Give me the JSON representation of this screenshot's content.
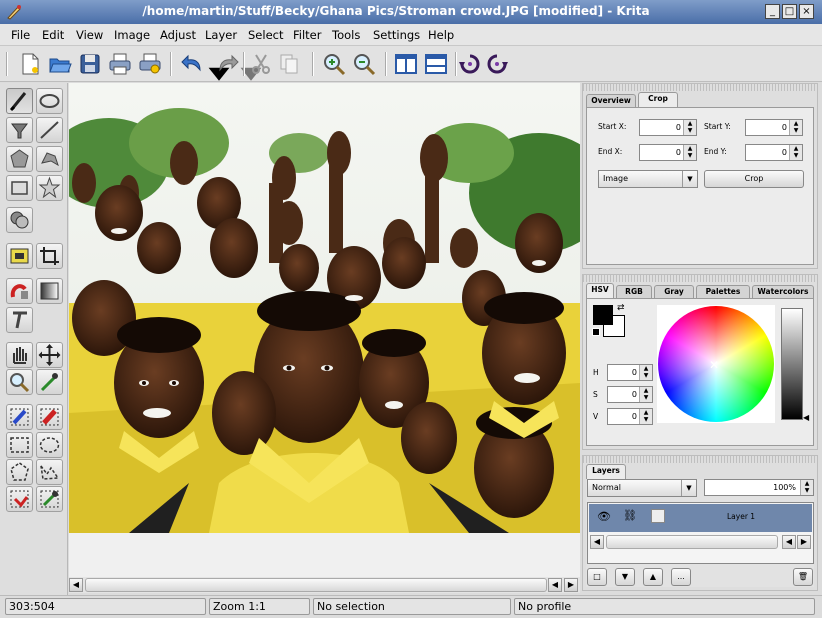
{
  "window": {
    "title": "/home/martin/Stuff/Becky/Ghana Pics/Stroman crowd.JPG [modified] - Krita",
    "buttons": {
      "minimize": "_",
      "maximize": "□",
      "close": "×"
    }
  },
  "menu": [
    {
      "label": "File"
    },
    {
      "label": "Edit"
    },
    {
      "label": "View"
    },
    {
      "label": "Image"
    },
    {
      "label": "Adjust"
    },
    {
      "label": "Layer"
    },
    {
      "label": "Select"
    },
    {
      "label": "Filter"
    },
    {
      "label": "Tools"
    },
    {
      "label": "Settings"
    },
    {
      "label": "Help"
    }
  ],
  "toolbar": {
    "icons": [
      "new-document-icon",
      "open-folder-icon",
      "save-icon",
      "print-icon",
      "print-preview-icon",
      "undo-icon",
      "redo-icon",
      "cut-icon",
      "copy-icon",
      "zoom-in-icon",
      "zoom-out-icon",
      "view-split-vertical-icon",
      "view-split-horizontal-icon",
      "rotate-ccw-icon",
      "rotate-cw-icon"
    ]
  },
  "toolbox": {
    "tools": [
      "brush",
      "ellipse",
      "fill",
      "line",
      "polygon",
      "polyline",
      "rectangle",
      "star",
      "duplicate",
      "move-selection",
      "crop",
      "gradient",
      "filter-brush",
      "text",
      "pan",
      "move",
      "zoom",
      "color-picker",
      "paint-selection",
      "eraser-selection",
      "rect-selection",
      "ellipse-selection",
      "polygon-selection",
      "outline-selection",
      "contiguous-selection",
      "color-selection"
    ]
  },
  "image": {
    "description_hidden": ""
  },
  "tool_options": {
    "tabs": [
      {
        "label": "Overview"
      },
      {
        "label": "Crop"
      }
    ],
    "active_tab": "Crop",
    "start_x_label": "Start X:",
    "start_x_value": "0",
    "start_y_label": "Start Y:",
    "start_y_value": "0",
    "end_x_label": "End X:",
    "end_x_value": "0",
    "end_y_label": "End Y:",
    "end_y_value": "0",
    "mode_value": "Image",
    "crop_button": "Crop"
  },
  "color_docker": {
    "tabs": [
      {
        "label": "HSV"
      },
      {
        "label": "RGB"
      },
      {
        "label": "Gray"
      },
      {
        "label": "Palettes"
      },
      {
        "label": "Watercolors"
      }
    ],
    "active_tab": "HSV",
    "h_label": "H",
    "h_value": "0",
    "s_label": "S",
    "s_value": "0",
    "v_label": "V",
    "v_value": "0",
    "foreground": "#000000",
    "background": "#ffffff"
  },
  "layers": {
    "tab": "Layers",
    "blend_mode": "Normal",
    "opacity": "100%",
    "items": [
      {
        "name": "Layer 1"
      }
    ],
    "add_button": "",
    "more_button": "..."
  },
  "status": {
    "coords": "303:504",
    "zoom": "Zoom 1:1",
    "selection": "No selection",
    "profile": "No profile"
  },
  "colors": {
    "title_bar": "#4a6ea8",
    "layer_selected": "#6f87ab"
  }
}
